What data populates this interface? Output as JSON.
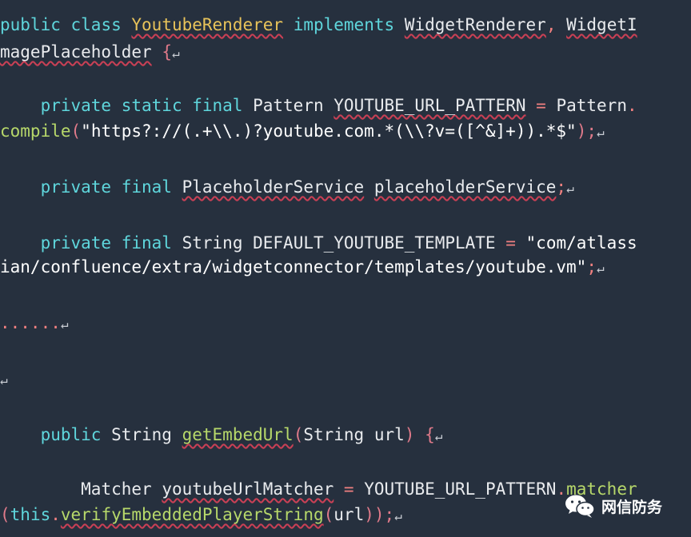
{
  "code": {
    "l1_kw1": "public",
    "l1_kw2": "class",
    "l1_cls": "YoutubeRenderer",
    "l1_kw3": "implements",
    "l1_if1": "WidgetRenderer",
    "l1_comma": ",",
    "l1_if2a": "WidgetI",
    "l2_if2b": "magePlaceholder",
    "l2_brace": "{",
    "l3_kw": "private static final",
    "l3_type": "Pattern",
    "l3_name": "YOUTUBE_URL_PATTERN",
    "l3_eq": "=",
    "l3_cls": "Pattern",
    "l3_dot": ".",
    "l4_method": "compile",
    "l4_lp": "(",
    "l4_str": "\"https?://(.+\\\\.)?youtube.com.*(\\\\?v=([^&]+)).*$\"",
    "l4_rp": ");",
    "l5_kw": "private final",
    "l5_type": "PlaceholderService",
    "l5_name": "placeholderService",
    "l5_semi": ";",
    "l6_kw": "private final",
    "l6_type": "String",
    "l6_name": "DEFAULT_YOUTUBE_TEMPLATE",
    "l6_eq": "=",
    "l6_str1": "\"com/atlass",
    "l7_str2": "ian/confluence/extra/widgetconnector/templates/youtube.vm\"",
    "l7_semi": ";",
    "l8_dots": "......",
    "l10_kw": "public",
    "l10_type": "String",
    "l10_method": "getEmbedUrl",
    "l10_lp": "(",
    "l10_ptype": "String",
    "l10_pname": "url",
    "l10_rp": ")",
    "l10_brace": "{",
    "l11_type": "Matcher",
    "l11_name": "youtubeUrlMatcher",
    "l11_eq": "=",
    "l11_const": "YOUTUBE_URL_PATTERN",
    "l11_dot": ".",
    "l11_method": "matcher",
    "l12_lp": "(",
    "l12_this": "this",
    "l12_dot": ".",
    "l12_method": "verifyEmbeddedPlayerString",
    "l12_lp2": "(",
    "l12_arg": "url",
    "l12_rp": "));",
    "return_glyph": "↵"
  },
  "watermark": {
    "text": "网信防务",
    "icon": "wechat-icon"
  },
  "colors": {
    "background": "#26303e",
    "keyword": "#5fd6dc",
    "class": "#e8c35a",
    "method": "#b7d86a",
    "error_underline": "#c94055"
  }
}
